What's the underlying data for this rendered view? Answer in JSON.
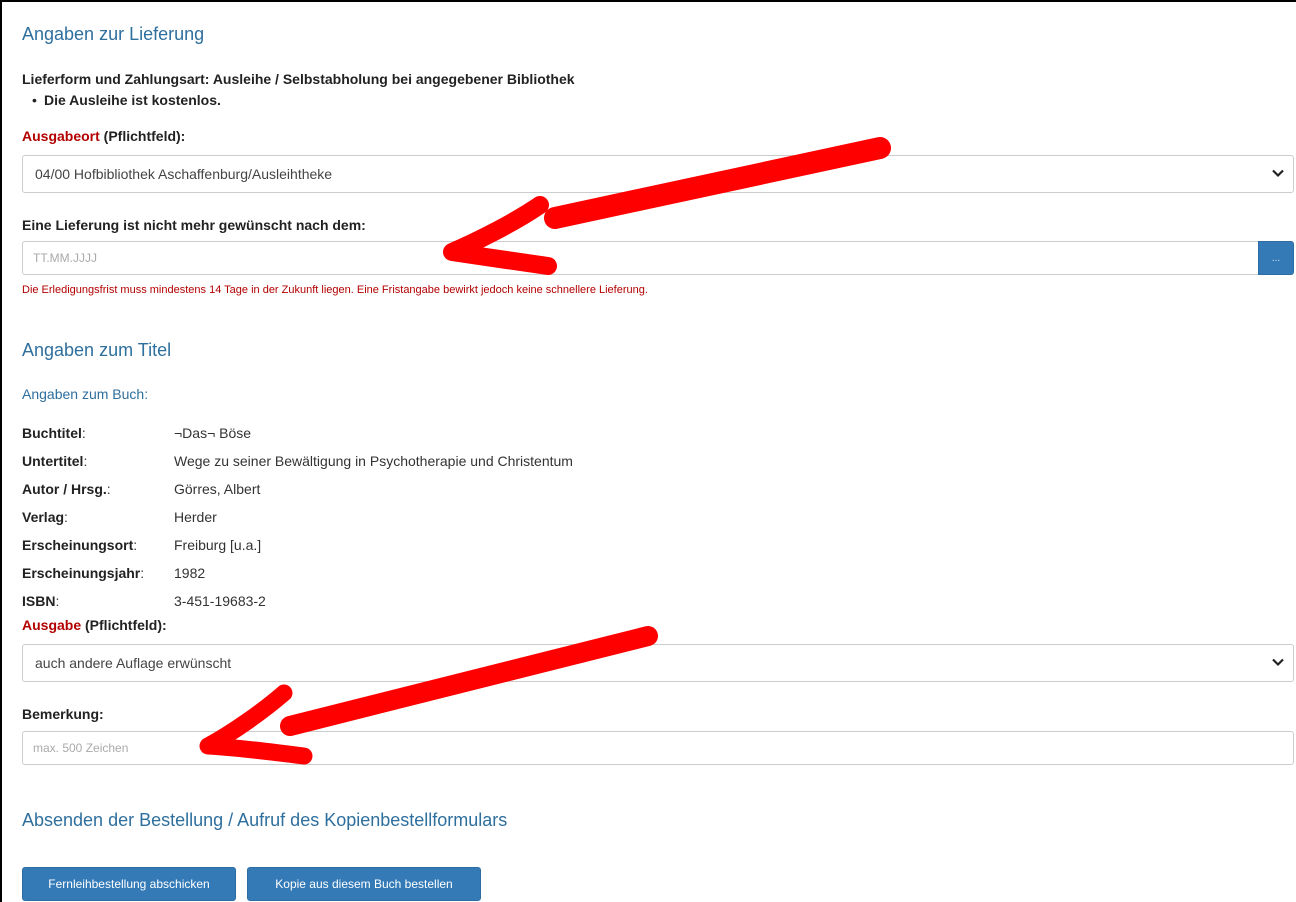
{
  "delivery": {
    "heading": "Angaben zur Lieferung",
    "delivery_form": "Lieferform und Zahlungsart: Ausleihe / Selbstabholung bei angegebener Bibliothek",
    "bullet": "Die Ausleihe ist kostenlos.",
    "pickup_label_req": "Ausgabeort",
    "pickup_label_rest": " (Pflichtfeld):",
    "pickup_value": "04/00 Hofbibliothek Aschaffenburg/Ausleihtheke",
    "deadline_label": "Eine Lieferung ist nicht mehr gewünscht nach dem:",
    "deadline_placeholder": "TT.MM.JJJJ",
    "deadline_button": "...",
    "deadline_hint": "Die Erledigungsfrist muss mindestens 14 Tage in der Zukunft liegen. Eine Fristangabe bewirkt jedoch keine schnellere Lieferung."
  },
  "title_info": {
    "heading": "Angaben zum Titel",
    "subheading": "Angaben zum Buch:",
    "fields": [
      {
        "label": "Buchtitel",
        "value": "¬Das¬ Böse"
      },
      {
        "label": "Untertitel",
        "value": "Wege zu seiner Bewältigung in Psychotherapie und Christentum"
      },
      {
        "label": "Autor / Hrsg.",
        "value": "Görres, Albert"
      },
      {
        "label": "Verlag",
        "value": "Herder"
      },
      {
        "label": "Erscheinungsort",
        "value": "Freiburg [u.a.]"
      },
      {
        "label": "Erscheinungsjahr",
        "value": "1982"
      },
      {
        "label": "ISBN",
        "value": "3-451-19683-2"
      }
    ],
    "edition_label_req": "Ausgabe",
    "edition_label_rest": " (Pflichtfeld):",
    "edition_value": "auch andere Auflage erwünscht",
    "remark_label": "Bemerkung:",
    "remark_placeholder": "max. 500 Zeichen"
  },
  "submit": {
    "heading": "Absenden der Bestellung / Aufruf des Kopienbestellformulars",
    "send_button": "Fernleihbestellung abschicken",
    "copy_button": "Kopie aus diesem Buch bestellen"
  },
  "colors": {
    "heading": "#2e6f9e",
    "required": "#b30000",
    "button": "#337ab7",
    "annotation_arrow": "#ff0000"
  },
  "icons": {
    "select_chevron": "chevron-down-icon",
    "annotation": "red-arrow-icon"
  }
}
